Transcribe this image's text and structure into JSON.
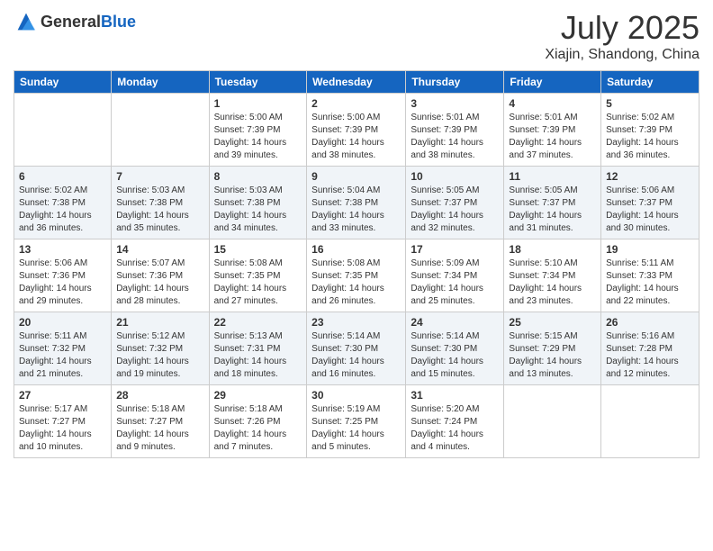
{
  "header": {
    "logo_general": "General",
    "logo_blue": "Blue",
    "month_title": "July 2025",
    "location": "Xiajin, Shandong, China"
  },
  "weekdays": [
    "Sunday",
    "Monday",
    "Tuesday",
    "Wednesday",
    "Thursday",
    "Friday",
    "Saturday"
  ],
  "weeks": [
    [
      {
        "day": "",
        "sunrise": "",
        "sunset": "",
        "daylight": ""
      },
      {
        "day": "",
        "sunrise": "",
        "sunset": "",
        "daylight": ""
      },
      {
        "day": "1",
        "sunrise": "Sunrise: 5:00 AM",
        "sunset": "Sunset: 7:39 PM",
        "daylight": "Daylight: 14 hours and 39 minutes."
      },
      {
        "day": "2",
        "sunrise": "Sunrise: 5:00 AM",
        "sunset": "Sunset: 7:39 PM",
        "daylight": "Daylight: 14 hours and 38 minutes."
      },
      {
        "day": "3",
        "sunrise": "Sunrise: 5:01 AM",
        "sunset": "Sunset: 7:39 PM",
        "daylight": "Daylight: 14 hours and 38 minutes."
      },
      {
        "day": "4",
        "sunrise": "Sunrise: 5:01 AM",
        "sunset": "Sunset: 7:39 PM",
        "daylight": "Daylight: 14 hours and 37 minutes."
      },
      {
        "day": "5",
        "sunrise": "Sunrise: 5:02 AM",
        "sunset": "Sunset: 7:39 PM",
        "daylight": "Daylight: 14 hours and 36 minutes."
      }
    ],
    [
      {
        "day": "6",
        "sunrise": "Sunrise: 5:02 AM",
        "sunset": "Sunset: 7:38 PM",
        "daylight": "Daylight: 14 hours and 36 minutes."
      },
      {
        "day": "7",
        "sunrise": "Sunrise: 5:03 AM",
        "sunset": "Sunset: 7:38 PM",
        "daylight": "Daylight: 14 hours and 35 minutes."
      },
      {
        "day": "8",
        "sunrise": "Sunrise: 5:03 AM",
        "sunset": "Sunset: 7:38 PM",
        "daylight": "Daylight: 14 hours and 34 minutes."
      },
      {
        "day": "9",
        "sunrise": "Sunrise: 5:04 AM",
        "sunset": "Sunset: 7:38 PM",
        "daylight": "Daylight: 14 hours and 33 minutes."
      },
      {
        "day": "10",
        "sunrise": "Sunrise: 5:05 AM",
        "sunset": "Sunset: 7:37 PM",
        "daylight": "Daylight: 14 hours and 32 minutes."
      },
      {
        "day": "11",
        "sunrise": "Sunrise: 5:05 AM",
        "sunset": "Sunset: 7:37 PM",
        "daylight": "Daylight: 14 hours and 31 minutes."
      },
      {
        "day": "12",
        "sunrise": "Sunrise: 5:06 AM",
        "sunset": "Sunset: 7:37 PM",
        "daylight": "Daylight: 14 hours and 30 minutes."
      }
    ],
    [
      {
        "day": "13",
        "sunrise": "Sunrise: 5:06 AM",
        "sunset": "Sunset: 7:36 PM",
        "daylight": "Daylight: 14 hours and 29 minutes."
      },
      {
        "day": "14",
        "sunrise": "Sunrise: 5:07 AM",
        "sunset": "Sunset: 7:36 PM",
        "daylight": "Daylight: 14 hours and 28 minutes."
      },
      {
        "day": "15",
        "sunrise": "Sunrise: 5:08 AM",
        "sunset": "Sunset: 7:35 PM",
        "daylight": "Daylight: 14 hours and 27 minutes."
      },
      {
        "day": "16",
        "sunrise": "Sunrise: 5:08 AM",
        "sunset": "Sunset: 7:35 PM",
        "daylight": "Daylight: 14 hours and 26 minutes."
      },
      {
        "day": "17",
        "sunrise": "Sunrise: 5:09 AM",
        "sunset": "Sunset: 7:34 PM",
        "daylight": "Daylight: 14 hours and 25 minutes."
      },
      {
        "day": "18",
        "sunrise": "Sunrise: 5:10 AM",
        "sunset": "Sunset: 7:34 PM",
        "daylight": "Daylight: 14 hours and 23 minutes."
      },
      {
        "day": "19",
        "sunrise": "Sunrise: 5:11 AM",
        "sunset": "Sunset: 7:33 PM",
        "daylight": "Daylight: 14 hours and 22 minutes."
      }
    ],
    [
      {
        "day": "20",
        "sunrise": "Sunrise: 5:11 AM",
        "sunset": "Sunset: 7:32 PM",
        "daylight": "Daylight: 14 hours and 21 minutes."
      },
      {
        "day": "21",
        "sunrise": "Sunrise: 5:12 AM",
        "sunset": "Sunset: 7:32 PM",
        "daylight": "Daylight: 14 hours and 19 minutes."
      },
      {
        "day": "22",
        "sunrise": "Sunrise: 5:13 AM",
        "sunset": "Sunset: 7:31 PM",
        "daylight": "Daylight: 14 hours and 18 minutes."
      },
      {
        "day": "23",
        "sunrise": "Sunrise: 5:14 AM",
        "sunset": "Sunset: 7:30 PM",
        "daylight": "Daylight: 14 hours and 16 minutes."
      },
      {
        "day": "24",
        "sunrise": "Sunrise: 5:14 AM",
        "sunset": "Sunset: 7:30 PM",
        "daylight": "Daylight: 14 hours and 15 minutes."
      },
      {
        "day": "25",
        "sunrise": "Sunrise: 5:15 AM",
        "sunset": "Sunset: 7:29 PM",
        "daylight": "Daylight: 14 hours and 13 minutes."
      },
      {
        "day": "26",
        "sunrise": "Sunrise: 5:16 AM",
        "sunset": "Sunset: 7:28 PM",
        "daylight": "Daylight: 14 hours and 12 minutes."
      }
    ],
    [
      {
        "day": "27",
        "sunrise": "Sunrise: 5:17 AM",
        "sunset": "Sunset: 7:27 PM",
        "daylight": "Daylight: 14 hours and 10 minutes."
      },
      {
        "day": "28",
        "sunrise": "Sunrise: 5:18 AM",
        "sunset": "Sunset: 7:27 PM",
        "daylight": "Daylight: 14 hours and 9 minutes."
      },
      {
        "day": "29",
        "sunrise": "Sunrise: 5:18 AM",
        "sunset": "Sunset: 7:26 PM",
        "daylight": "Daylight: 14 hours and 7 minutes."
      },
      {
        "day": "30",
        "sunrise": "Sunrise: 5:19 AM",
        "sunset": "Sunset: 7:25 PM",
        "daylight": "Daylight: 14 hours and 5 minutes."
      },
      {
        "day": "31",
        "sunrise": "Sunrise: 5:20 AM",
        "sunset": "Sunset: 7:24 PM",
        "daylight": "Daylight: 14 hours and 4 minutes."
      },
      {
        "day": "",
        "sunrise": "",
        "sunset": "",
        "daylight": ""
      },
      {
        "day": "",
        "sunrise": "",
        "sunset": "",
        "daylight": ""
      }
    ]
  ]
}
